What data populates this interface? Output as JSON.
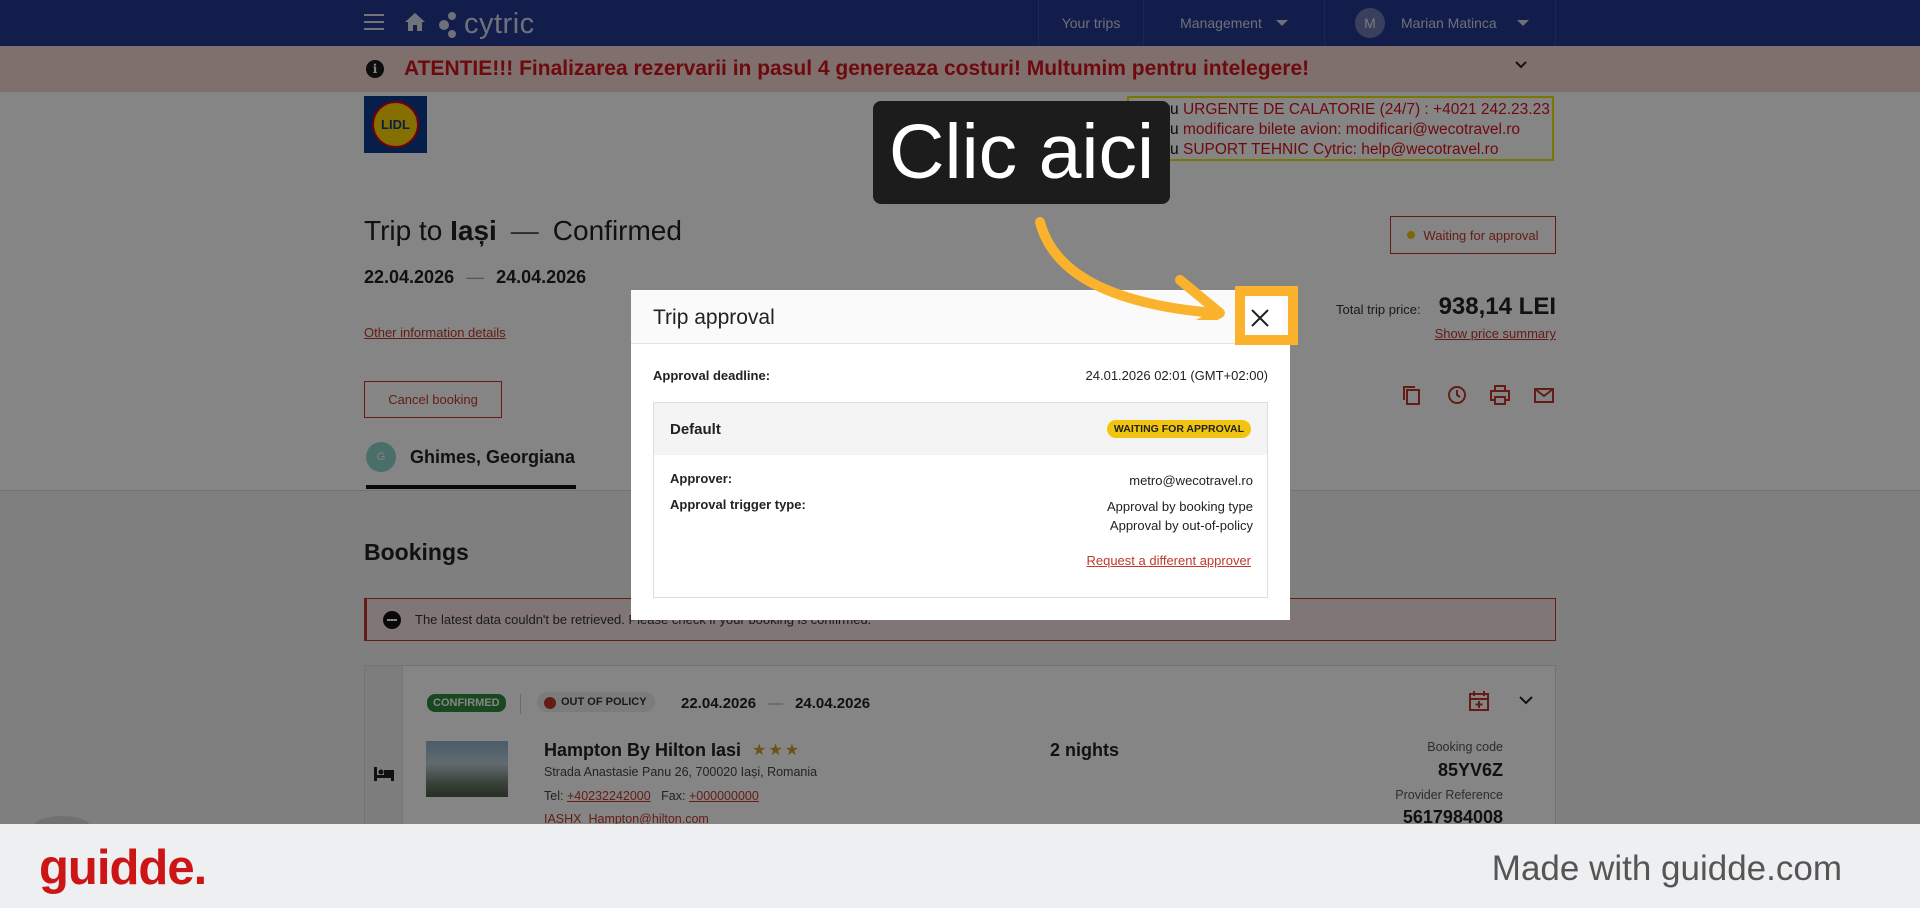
{
  "nav": {
    "brand": "cytric",
    "your_trips": "Your trips",
    "management": "Management",
    "user_initial": "M",
    "user_name": "Marian Matinca"
  },
  "banner": {
    "message": "ATENTIE!!! Finalizarea rezervarii in pasul 4 genereaza costuri! Multumim pentru intelegere!"
  },
  "company_logo": "LIDL",
  "urgent_info": {
    "line1_prefix": "Pentru",
    "line1_text": " URGENTE DE CALATORIE (24/7) : +4021 242.23.23",
    "line2_prefix": "Pentru",
    "line2_text": " modificare bilete avion:  modificari@wecotravel.ro",
    "line3_prefix": "Pentru",
    "line3_text": " SUPORT TEHNIC Cytric:  help@wecotravel.ro"
  },
  "trip": {
    "title_prefix": "Trip to ",
    "destination": "Iași",
    "dash": "—",
    "status": "Confirmed",
    "start_date": "22.04.2026",
    "date_sep": "—",
    "end_date": "24.04.2026",
    "other_info": "Other information details",
    "cancel_label": "Cancel booking",
    "approval_status": "Waiting for approval",
    "total_price_label": "Total trip price:",
    "total_price": "938,14 LEI",
    "price_summary": "Show price summary"
  },
  "traveler": {
    "initials": "G",
    "name": "Ghimes, Georgiana"
  },
  "bookings": {
    "heading": "Bookings",
    "error_message": "The latest data couldn't be retrieved. Please check if your booking is confirmed.",
    "card": {
      "status": "CONFIRMED",
      "policy": "OUT OF POLICY",
      "start_date": "22.04.2026",
      "end_date": "24.04.2026",
      "hotel_name": "Hampton By Hilton Iasi",
      "stars": "★★★",
      "address": "Strada Anastasie Panu 26, 700020 Iași, Romania",
      "tel_label": "Tel: ",
      "tel": "+40232242000",
      "fax_label": "Fax: ",
      "fax": "+000000000",
      "email": "IASHX_Hampton@hilton.com",
      "nights": "2 nights",
      "booking_code_label": "Booking code",
      "booking_code": "85YV6Z",
      "provider_ref_label": "Provider Reference",
      "provider_ref": "5617984008"
    }
  },
  "modal": {
    "title": "Trip approval",
    "deadline_label": "Approval deadline:",
    "deadline_value": "24.01.2026 02:01 (GMT+02:00)",
    "box_title": "Default",
    "box_status": "WAITING FOR APPROVAL",
    "approver_label": "Approver:",
    "approver_value": "metro@wecotravel.ro",
    "trigger_label": "Approval trigger type:",
    "trigger_value_1": "Approval by booking type",
    "trigger_value_2": "Approval by out-of-policy",
    "request_link": "Request a different approver"
  },
  "annotation": {
    "callout": "Clic aici"
  },
  "footer": {
    "brand": "guidde.",
    "made_with": "Made with guidde.com"
  },
  "colors": {
    "nav_bg": "#263890",
    "accent_red": "#c0392b",
    "banner_text": "#d4141c",
    "highlight": "#fbb22c",
    "confirmed": "#2e8b3e",
    "waiting": "#f1c40f"
  }
}
